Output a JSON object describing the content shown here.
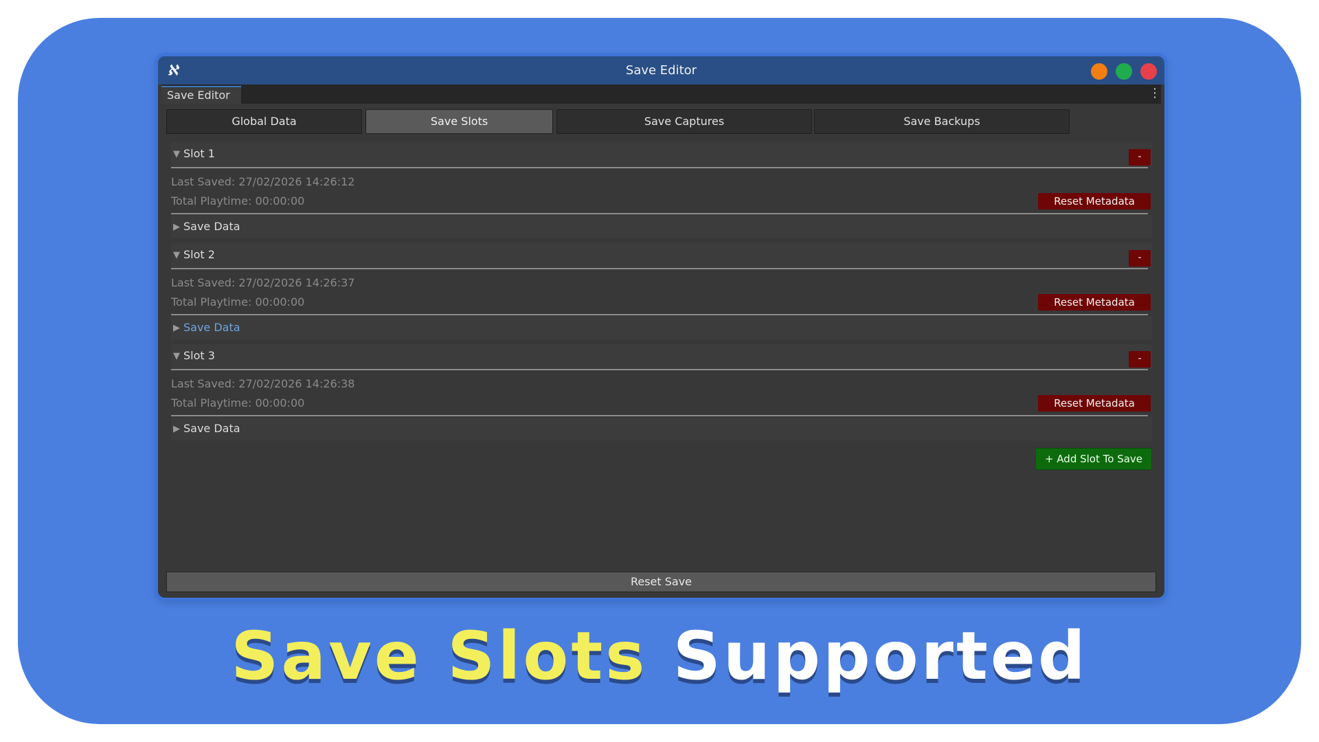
{
  "window": {
    "title": "Save Editor",
    "logo": "unity-logo-icon"
  },
  "doc_tab": {
    "label": "Save Editor"
  },
  "toolbar": {
    "tabs": [
      {
        "label": "Global Data",
        "active": false
      },
      {
        "label": "Save Slots",
        "active": true
      },
      {
        "label": "Save Captures",
        "active": false
      },
      {
        "label": "Save Backups",
        "active": false
      }
    ]
  },
  "slots": [
    {
      "title": "Slot 1",
      "last_saved": "Last Saved: 27/02/2026 14:26:12",
      "playtime": "Total Playtime: 00:00:00",
      "remove_label": "-",
      "reset_label": "Reset Metadata",
      "data_label": "Save Data"
    },
    {
      "title": "Slot 2",
      "last_saved": "Last Saved: 27/02/2026 14:26:37",
      "playtime": "Total Playtime: 00:00:00",
      "remove_label": "-",
      "reset_label": "Reset Metadata",
      "data_label": "Save Data"
    },
    {
      "title": "Slot 3",
      "last_saved": "Last Saved: 27/02/2026 14:26:38",
      "playtime": "Total Playtime: 00:00:00",
      "remove_label": "-",
      "reset_label": "Reset Metadata",
      "data_label": "Save Data"
    }
  ],
  "add_slot_label": "+ Add Slot To Save",
  "reset_save_label": "Reset Save",
  "caption": {
    "part1": "Save Slots",
    "part2": "Supported"
  },
  "colors": {
    "background": "#4a7fe0",
    "titlebar": "#2a4f86",
    "danger": "#6e0606",
    "success": "#0d6b0d",
    "caption_yellow": "#f3ef5c",
    "link": "#6ea3e0"
  }
}
